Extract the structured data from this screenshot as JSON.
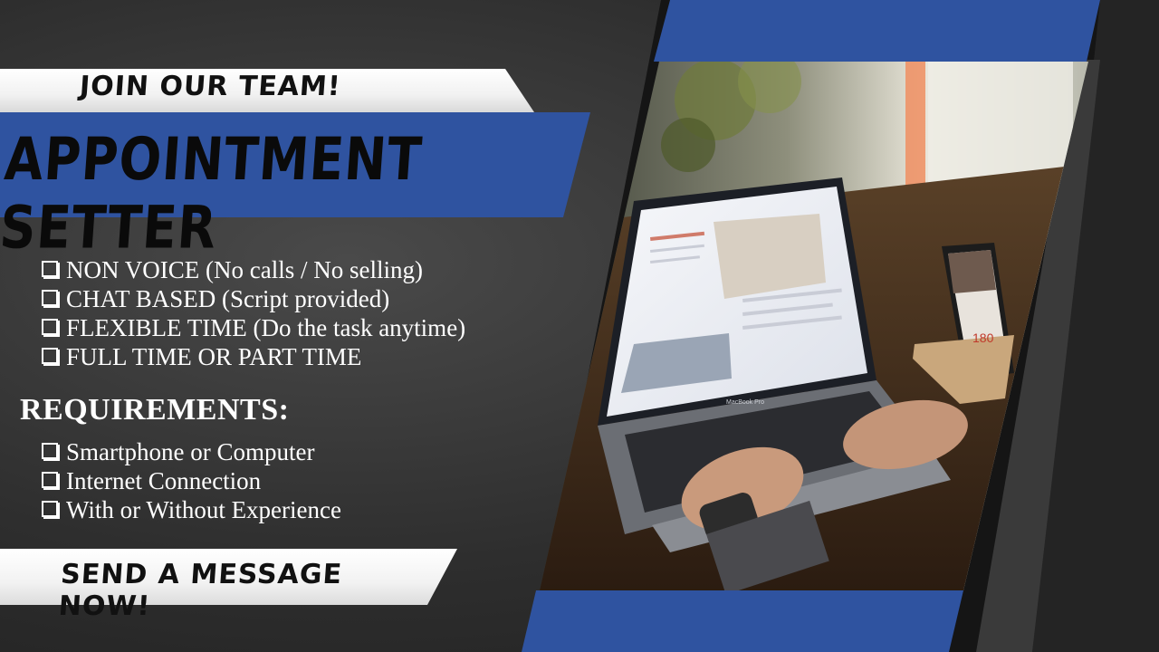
{
  "header": {
    "kicker": "JOIN OUR TEAM!",
    "title": "APPOINTMENT SETTER"
  },
  "benefits": {
    "items": [
      "NON VOICE (No calls / No selling)",
      "CHAT BASED (Script provided)",
      "FLEXIBLE TIME (Do the task anytime)",
      "FULL TIME OR PART TIME"
    ]
  },
  "requirements": {
    "title": "REQUIREMENTS:",
    "items": [
      "Smartphone or Computer",
      "Internet Connection",
      "With or Without Experience"
    ]
  },
  "cta": {
    "label": "SEND A MESSAGE NOW!"
  },
  "photo": {
    "laptop_label": "MacBook Pro",
    "phone_number": "180"
  },
  "colors": {
    "accent_blue": "#2f53a0",
    "background": "#2e2e2e",
    "banner_white": "#ffffff"
  }
}
